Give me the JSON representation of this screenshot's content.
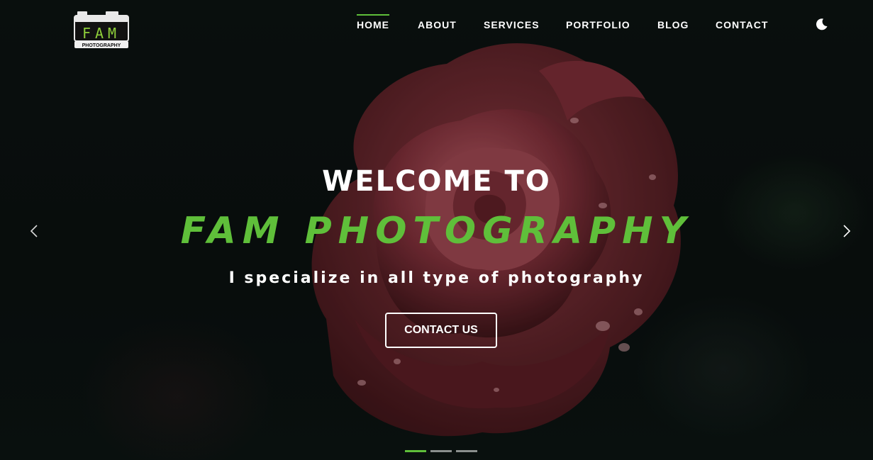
{
  "logo": {
    "letters": "FAM",
    "subtitle": "PHOTOGRAPHY"
  },
  "nav": {
    "items": [
      {
        "label": "HOME",
        "active": true
      },
      {
        "label": "ABOUT",
        "active": false
      },
      {
        "label": "SERVICES",
        "active": false
      },
      {
        "label": "PORTFOLIO",
        "active": false
      },
      {
        "label": "BLOG",
        "active": false
      },
      {
        "label": "CONTACT",
        "active": false
      }
    ],
    "theme_toggle_icon": "moon-icon"
  },
  "hero": {
    "welcome": "WELCOME TO",
    "brand": "FAM PHOTOGRAPHY",
    "tagline": "I specialize in all type of photography",
    "cta_label": "CONTACT US",
    "background_subject": "red-rose"
  },
  "carousel": {
    "prev_icon": "chevron-left-icon",
    "next_icon": "chevron-right-icon",
    "slide_count": 3,
    "active_slide": 1
  },
  "colors": {
    "accent": "#5fbf3a",
    "background": "#0b1210",
    "text": "#ffffff"
  }
}
